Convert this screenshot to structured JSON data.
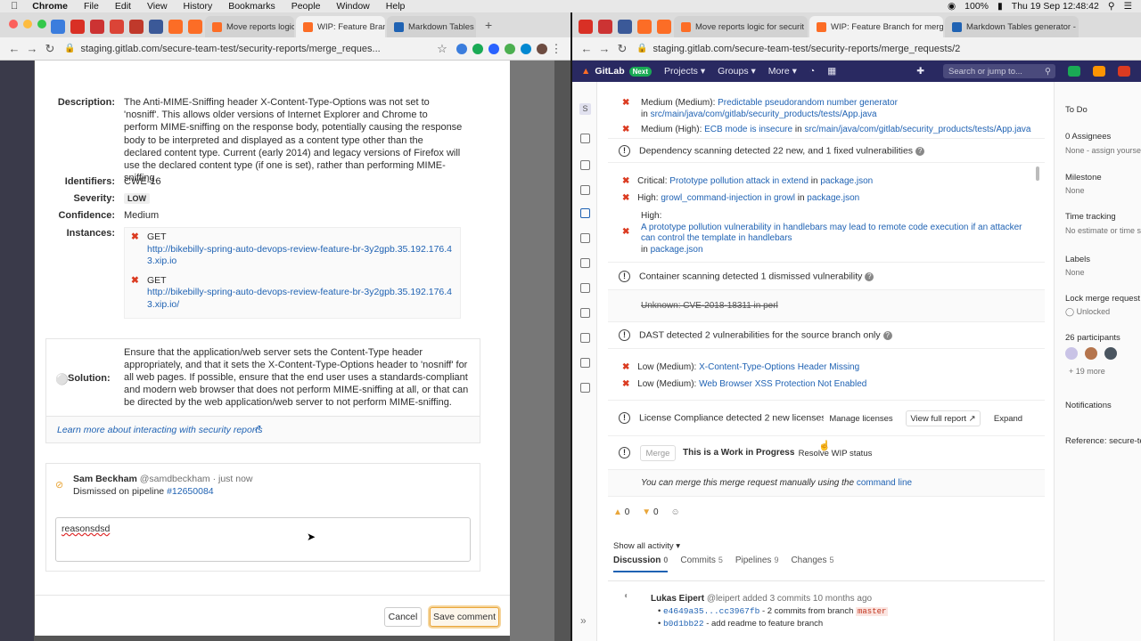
{
  "menubar": {
    "app": "Chrome",
    "items": [
      "File",
      "Edit",
      "View",
      "History",
      "Bookmarks",
      "People",
      "Window",
      "Help"
    ],
    "battery": "100%",
    "clock": "Thu 19 Sep  12:48:42"
  },
  "left": {
    "tabs": [
      "Move reports logic fo",
      "WIP: Feature Branc"
    ],
    "url": "staging.gitlab.com/secure-team-test/security-reports/merge_reques...",
    "details": {
      "description_label": "Description:",
      "description": "The Anti-MIME-Sniffing header X-Content-Type-Options was not set to 'nosniff'. This allows older versions of Internet Explorer and Chrome to perform MIME-sniffing on the response body, potentially causing the response body to be interpreted and displayed as a content type other than the declared content type. Current (early 2014) and legacy versions of Firefox will use the declared content type (if one is set), rather than performing MIME-sniffing.",
      "identifiers_label": "Identifiers:",
      "identifier": "CWE-16",
      "severity_label": "Severity:",
      "severity": "LOW",
      "confidence_label": "Confidence:",
      "confidence": "Medium",
      "instances_label": "Instances:",
      "instances": [
        {
          "method": "GET",
          "url": "http://bikebilly-spring-auto-devops-review-feature-br-3y2gpb.35.192.176.43.xip.io"
        },
        {
          "method": "GET",
          "url": "http://bikebilly-spring-auto-devops-review-feature-br-3y2gpb.35.192.176.43.xip.io/"
        }
      ]
    },
    "solution_label": "Solution:",
    "solution": "Ensure that the application/web server sets the Content-Type header appropriately, and that it sets the X-Content-Type-Options header to 'nosniff' for all web pages. If possible, ensure that the end user uses a standards-compliant and modern web browser that does not perform MIME-sniffing at all, or that can be directed by the web application/web server to not perform MIME-sniffing.",
    "learn_more": "Learn more about interacting with security reports",
    "comment": {
      "author": "Sam Beckham",
      "handle": "@samdbeckham · just now",
      "dismissed": "Dismissed on pipeline",
      "pipeline": "#12650084",
      "text": "reasonsdsd"
    },
    "cancel": "Cancel",
    "save": "Save comment"
  },
  "right": {
    "tabs": [
      "Move reports logic for securit",
      "WIP: Feature Branch for merge",
      "Markdown Tables generator -"
    ],
    "url": "staging.gitlab.com/secure-team-test/security-reports/merge_requests/2",
    "nav": {
      "brand": "GitLab",
      "next": "Next",
      "projects": "Projects",
      "groups": "Groups",
      "more": "More",
      "search": "Search or jump to..."
    },
    "sast_items": [
      {
        "sev": "Medium (Medium):",
        "title": "Predictable pseudorandom number generator",
        "in": "in",
        "file": "src/main/java/com/gitlab/security_products/tests/App.java"
      },
      {
        "sev": "Medium (High):",
        "title": "ECB mode is insecure",
        "in": "in",
        "file": "src/main/java/com/gitlab/security_products/tests/App.java"
      }
    ],
    "dependency": {
      "summary": "Dependency scanning detected 22 new, and 1 fixed vulnerabilities",
      "items": [
        {
          "sev": "Critical:",
          "title": "Prototype pollution attack in extend",
          "in": "in",
          "file": "package.json"
        },
        {
          "sev": "High:",
          "title": "growl_command-injection in growl",
          "in": "in",
          "file": "package.json"
        }
      ],
      "long_sev": "High:",
      "long_title": "A prototype pollution vulnerability in handlebars may lead to remote code execution if an attacker can control the template in handlebars",
      "long_in": "in",
      "long_file": "package.json"
    },
    "container": {
      "summary": "Container scanning detected 1 dismissed vulnerability",
      "item": "Unknown: CVE-2018-18311 in perl"
    },
    "dast": {
      "summary": "DAST detected 2 vulnerabilities for the source branch only",
      "items": [
        {
          "sev": "Low (Medium):",
          "title": "X-Content-Type-Options Header Missing"
        },
        {
          "sev": "Low (Medium):",
          "title": "Web Browser XSS Protection Not Enabled"
        }
      ]
    },
    "license": {
      "summary": "License Compliance detected 2 new licenses",
      "manage": "Manage licenses",
      "full": "View full report",
      "expand": "Expand"
    },
    "merge": {
      "button": "Merge",
      "wip": "This is a Work in Progress",
      "resolve": "Resolve WIP status",
      "manual": "You can merge this merge request manually using the",
      "cmd": "command line"
    },
    "reactions": {
      "up": "0",
      "down": "0"
    },
    "activity": "Show all activity",
    "tabs2": [
      {
        "label": "Discussion",
        "count": "0"
      },
      {
        "label": "Commits",
        "count": "5"
      },
      {
        "label": "Pipelines",
        "count": "9"
      },
      {
        "label": "Changes",
        "count": "5"
      }
    ],
    "note": {
      "author": "Lukas Eipert",
      "rest": "@leipert added 3 commits 10 months ago",
      "c1": "e4649a35...cc3967fb",
      "c1_text": "- 2 commits from branch",
      "branch": "master",
      "c2": "b0d1bb22",
      "c2_text": "- add readme to feature branch"
    },
    "sidebar": {
      "todo": "To Do",
      "assignees": "0 Assignees",
      "assign": "None - assign yourse",
      "milestone": "Milestone",
      "milestone_v": "None",
      "time": "Time tracking",
      "time_v": "No estimate or time s",
      "labels": "Labels",
      "labels_v": "None",
      "lock": "Lock merge request",
      "lock_v": "Unlocked",
      "participants": "26 participants",
      "more": "+ 19 more",
      "notifications": "Notifications",
      "reference": "Reference: secure-te"
    }
  }
}
